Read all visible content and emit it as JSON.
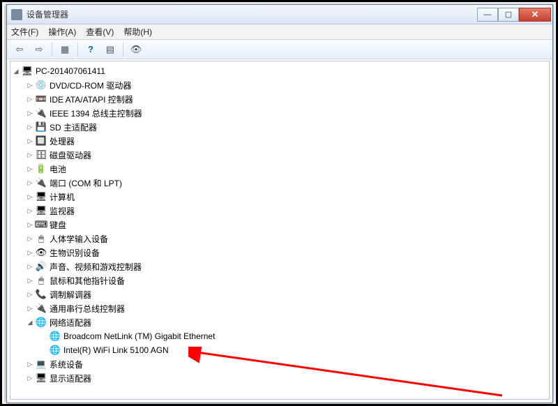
{
  "window": {
    "title": "设备管理器"
  },
  "menu": {
    "file": "文件(F)",
    "action": "操作(A)",
    "view": "查看(V)",
    "help": "帮助(H)"
  },
  "tree": {
    "root": "PC-201407061411",
    "items": [
      {
        "label": "DVD/CD-ROM 驱动器",
        "icon": "💿"
      },
      {
        "label": "IDE ATA/ATAPI 控制器",
        "icon": "📼"
      },
      {
        "label": "IEEE 1394 总线主控制器",
        "icon": "🔌"
      },
      {
        "label": "SD 主适配器",
        "icon": "💾"
      },
      {
        "label": "处理器",
        "icon": "🔲"
      },
      {
        "label": "磁盘驱动器",
        "icon": "🗄"
      },
      {
        "label": "电池",
        "icon": "🔋"
      },
      {
        "label": "端口 (COM 和 LPT)",
        "icon": "🔌"
      },
      {
        "label": "计算机",
        "icon": "🖥"
      },
      {
        "label": "监视器",
        "icon": "🖥"
      },
      {
        "label": "键盘",
        "icon": "⌨"
      },
      {
        "label": "人体学输入设备",
        "icon": "🖱"
      },
      {
        "label": "生物识别设备",
        "icon": "👁"
      },
      {
        "label": "声音、视频和游戏控制器",
        "icon": "🔊"
      },
      {
        "label": "鼠标和其他指针设备",
        "icon": "🖱"
      },
      {
        "label": "调制解调器",
        "icon": "📞"
      },
      {
        "label": "通用串行总线控制器",
        "icon": "🔌"
      }
    ],
    "network": {
      "label": "网络适配器",
      "icon": "🌐",
      "children": [
        {
          "label": "Broadcom NetLink (TM) Gigabit Ethernet",
          "icon": "🌐"
        },
        {
          "label": "Intel(R) WiFi Link 5100 AGN",
          "icon": "🌐"
        }
      ]
    },
    "after": [
      {
        "label": "系统设备",
        "icon": "💻"
      },
      {
        "label": "显示适配器",
        "icon": "🖥"
      }
    ]
  }
}
